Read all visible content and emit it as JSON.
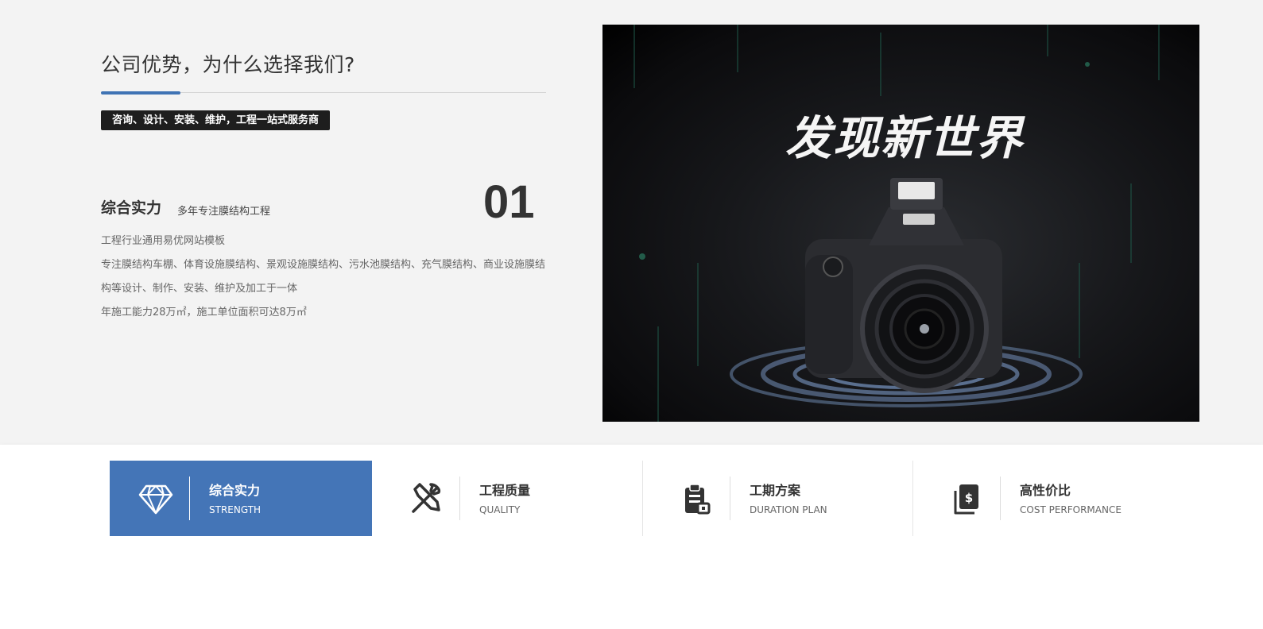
{
  "section": {
    "title": "公司优势，为什么选择我们?",
    "tagline": "咨询、设计、安装、维护，工程一站式服务商"
  },
  "feature": {
    "title": "综合实力",
    "subtitle": "多年专注膜结构工程",
    "number": "01",
    "lines": [
      "工程行业通用易优网站模板",
      "专注膜结构车棚、体育设施膜结构、景观设施膜结构、污水池膜结构、充气膜结构、商业设施膜结构等设计、制作、安装、维护及加工于一体",
      "年施工能力28万㎡，施工单位面积可达8万㎡"
    ]
  },
  "hero": {
    "text": "发现新世界"
  },
  "tabs": [
    {
      "title": "综合实力",
      "subtitle": "STRENGTH",
      "icon": "diamond-icon",
      "active": true
    },
    {
      "title": "工程质量",
      "subtitle": "QUALITY",
      "icon": "tools-icon",
      "active": false
    },
    {
      "title": "工期方案",
      "subtitle": "DURATION PLAN",
      "icon": "clipboard-icon",
      "active": false
    },
    {
      "title": "高性价比",
      "subtitle": "COST PERFORMANCE",
      "icon": "money-book-icon",
      "active": false
    }
  ],
  "colors": {
    "accent": "#4475b7",
    "tagline_bg": "#1e1e1e"
  }
}
